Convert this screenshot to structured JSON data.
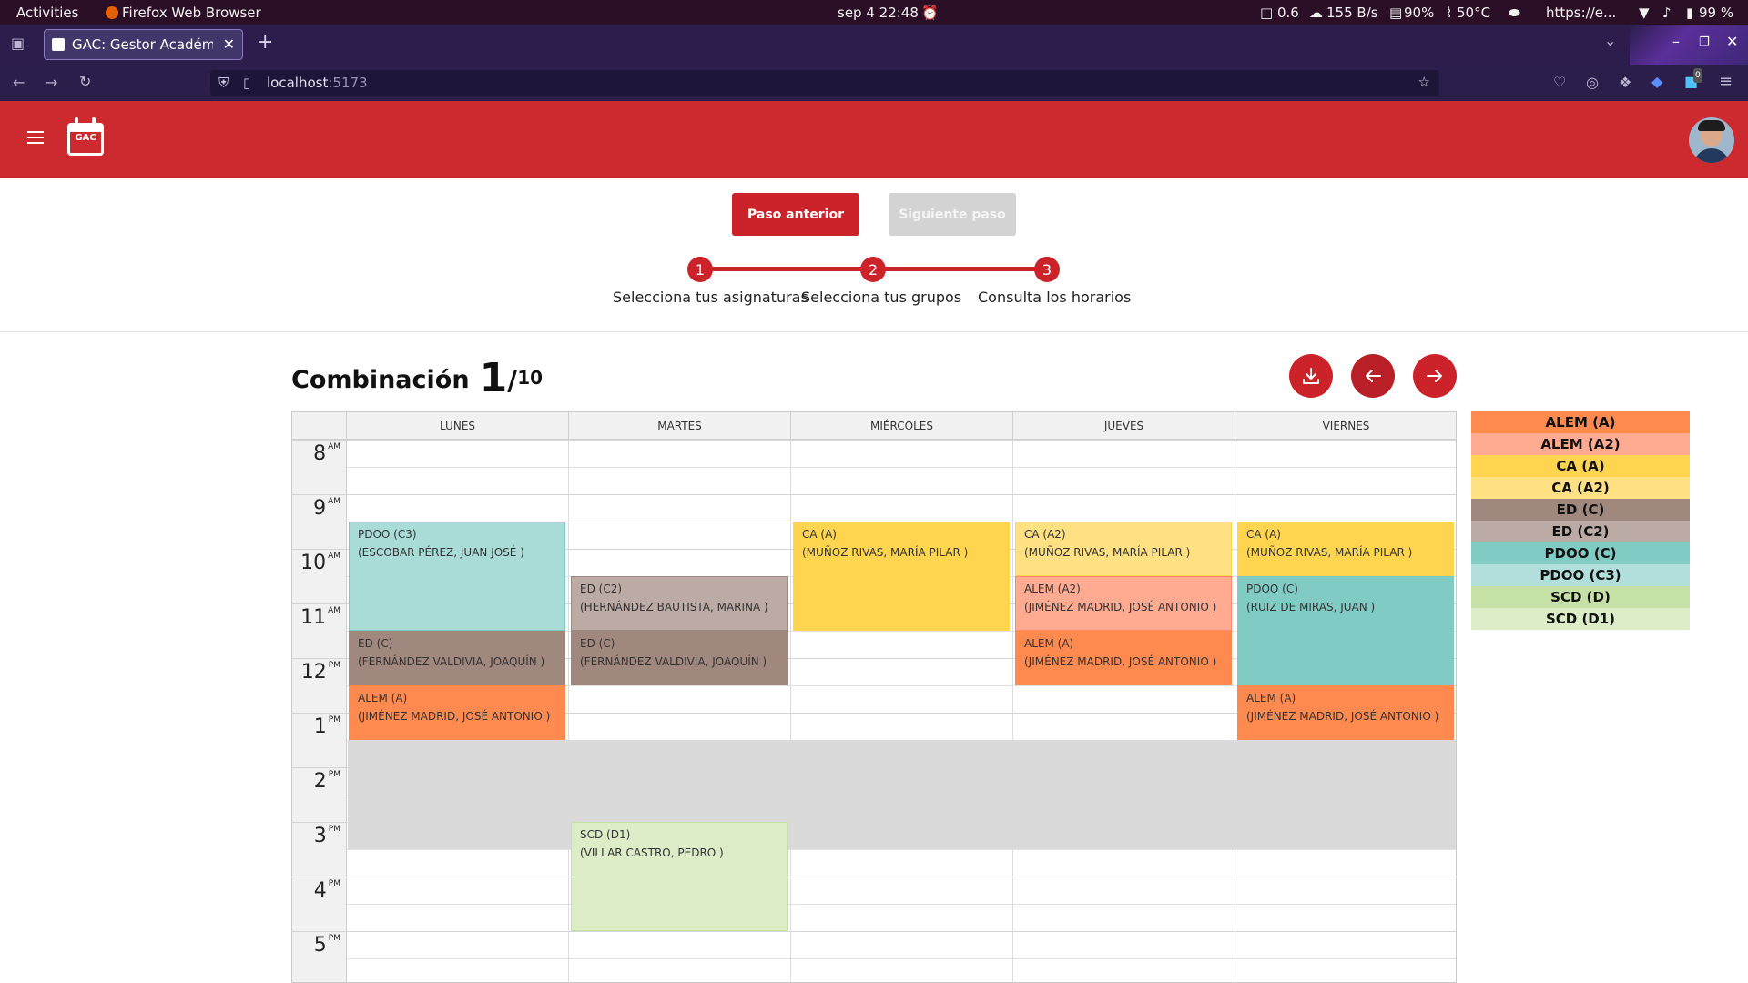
{
  "os": {
    "activities": "Activities",
    "app_name": "Firefox Web Browser",
    "datetime": "sep 4  22:48",
    "load": "0.6",
    "net": "155 B/s",
    "mem": "90%",
    "temp": "50°C",
    "url_short": "https://e...",
    "battery": "99 %"
  },
  "browser": {
    "tab_title": "GAC: Gestor Académico d",
    "url_host": "localhost",
    "url_port": ":5173",
    "ext_badge": "0"
  },
  "app": {
    "logo_text": "GAC"
  },
  "stepper": {
    "prev_label": "Paso anterior",
    "next_label": "Siguiente paso",
    "steps": [
      {
        "num": "1",
        "label": "Selecciona tus asignaturas"
      },
      {
        "num": "2",
        "label": "Selecciona tus grupos"
      },
      {
        "num": "3",
        "label": "Consulta los horarios"
      }
    ]
  },
  "combination": {
    "label": "Combinación",
    "current": "1",
    "sep": "/",
    "total": "10"
  },
  "calendar": {
    "days": [
      "LUNES",
      "MARTES",
      "MIÉRCOLES",
      "JUEVES",
      "VIERNES"
    ],
    "hours": [
      {
        "h": "8",
        "p": "AM"
      },
      {
        "h": "9",
        "p": "AM"
      },
      {
        "h": "10",
        "p": "AM"
      },
      {
        "h": "11",
        "p": "AM"
      },
      {
        "h": "12",
        "p": "PM"
      },
      {
        "h": "1",
        "p": "PM"
      },
      {
        "h": "2",
        "p": "PM"
      },
      {
        "h": "3",
        "p": "PM"
      },
      {
        "h": "4",
        "p": "PM"
      },
      {
        "h": "5",
        "p": "PM"
      }
    ],
    "events": [
      {
        "day": 0,
        "start": 9.5,
        "end": 11.5,
        "title": "PDOO (C3)",
        "teacher": "(ESCOBAR PÉREZ, JUAN JOSÉ )",
        "color": "#a9dcd6",
        "border": "#7bc9c0"
      },
      {
        "day": 0,
        "start": 11.5,
        "end": 12.5,
        "title": "ED (C)",
        "teacher": "(FERNÁNDEZ VALDIVIA, JOAQUÍN )",
        "color": "#a1887f",
        "border": "#a1887f"
      },
      {
        "day": 0,
        "start": 12.5,
        "end": 13.5,
        "title": "ALEM (A)",
        "teacher": "(JIMÉNEZ MADRID, JOSÉ ANTONIO )",
        "color": "#ff8a50",
        "border": "#ff8a50"
      },
      {
        "day": 1,
        "start": 10.5,
        "end": 11.5,
        "title": "ED (C2)",
        "teacher": "(HERNÁNDEZ BAUTISTA, MARINA )",
        "color": "#bcaaa4",
        "border": "#9e8a83"
      },
      {
        "day": 1,
        "start": 11.5,
        "end": 12.5,
        "title": "ED (C)",
        "teacher": "(FERNÁNDEZ VALDIVIA, JOAQUÍN )",
        "color": "#a1887f",
        "border": "#a1887f"
      },
      {
        "day": 1,
        "start": 15.0,
        "end": 17.0,
        "title": "SCD (D1)",
        "teacher": "(VILLAR CASTRO, PEDRO )",
        "color": "#dcedc8",
        "border": "#c5e1a5"
      },
      {
        "day": 2,
        "start": 9.5,
        "end": 11.5,
        "title": "CA (A)",
        "teacher": "(MUÑOZ RIVAS, MARÍA PILAR )",
        "color": "#ffd54f",
        "border": "#ffd54f"
      },
      {
        "day": 3,
        "start": 9.5,
        "end": 10.5,
        "title": "CA (A2)",
        "teacher": "(MUÑOZ RIVAS, MARÍA PILAR )",
        "color": "#ffe082",
        "border": "#ffd54f"
      },
      {
        "day": 3,
        "start": 10.5,
        "end": 11.5,
        "title": "ALEM (A2)",
        "teacher": "(JIMÉNEZ MADRID, JOSÉ ANTONIO )",
        "color": "#ffab91",
        "border": "#ff8a65"
      },
      {
        "day": 3,
        "start": 11.5,
        "end": 12.5,
        "title": "ALEM (A)",
        "teacher": "(JIMÉNEZ MADRID, JOSÉ ANTONIO )",
        "color": "#ff8a50",
        "border": "#ff8a50"
      },
      {
        "day": 4,
        "start": 9.5,
        "end": 10.5,
        "title": "CA (A)",
        "teacher": "(MUÑOZ RIVAS, MARÍA PILAR )",
        "color": "#ffd54f",
        "border": "#ffd54f"
      },
      {
        "day": 4,
        "start": 10.5,
        "end": 12.5,
        "title": "PDOO (C)",
        "teacher": "(RUIZ DE MIRAS, JUAN )",
        "color": "#80cbc4",
        "border": "#80cbc4"
      },
      {
        "day": 4,
        "start": 12.5,
        "end": 13.5,
        "title": "ALEM (A)",
        "teacher": "(JIMÉNEZ MADRID, JOSÉ ANTONIO )",
        "color": "#ff8a50",
        "border": "#ff8a50"
      }
    ]
  },
  "legend": [
    {
      "label": "ALEM (A)",
      "color": "#ff8a50"
    },
    {
      "label": "ALEM (A2)",
      "color": "#ffab91"
    },
    {
      "label": "CA (A)",
      "color": "#ffd54f"
    },
    {
      "label": "CA (A2)",
      "color": "#ffe082"
    },
    {
      "label": "ED (C)",
      "color": "#a1887f"
    },
    {
      "label": "ED (C2)",
      "color": "#bcaaa4"
    },
    {
      "label": "PDOO (C)",
      "color": "#80cbc4"
    },
    {
      "label": "PDOO (C3)",
      "color": "#b2dfdb"
    },
    {
      "label": "SCD (D)",
      "color": "#c5e1a5"
    },
    {
      "label": "SCD (D1)",
      "color": "#dcedc8"
    }
  ],
  "theme": {
    "primary": "#cd2a2f",
    "lunch": "#dadada"
  }
}
